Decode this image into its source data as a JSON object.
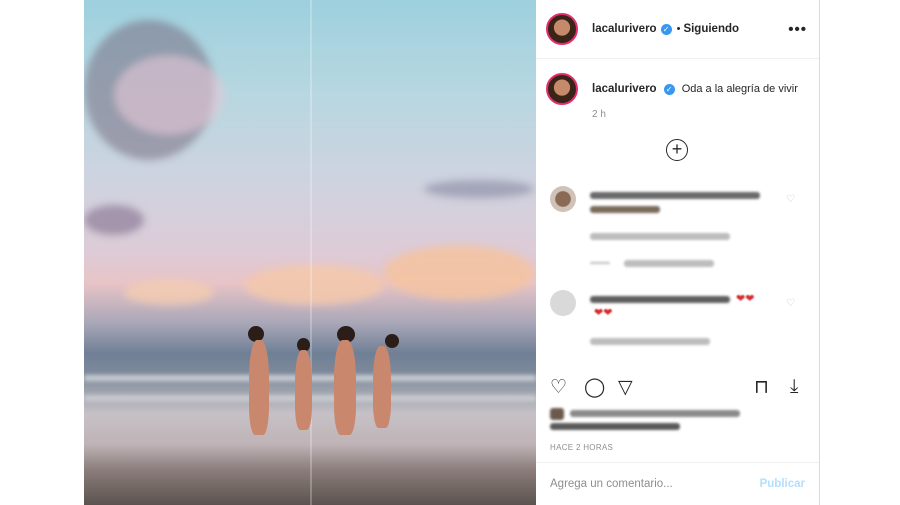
{
  "post": {
    "username": "lacalurivero",
    "verified_icon": "✓",
    "separator": "•",
    "follow_status": "Siguiendo",
    "more_options": "•••"
  },
  "caption": {
    "username": "lacalurivero",
    "text": "Oda a la alegría de vivir",
    "time": "2 h"
  },
  "load_more_icon": "+",
  "actions": {
    "like_icon": "heart-icon",
    "comment_icon": "comment-icon",
    "share_icon": "share-icon",
    "save_icon": "bookmark-icon",
    "download_icon": "download-icon"
  },
  "timestamp": "HACE 2 HORAS",
  "comment_box": {
    "placeholder": "Agrega un comentario...",
    "publish_label": "Publicar"
  },
  "colors": {
    "accent": "#3897f0",
    "publish_disabled": "#b2dffc",
    "story_ring": "#e1306c"
  }
}
